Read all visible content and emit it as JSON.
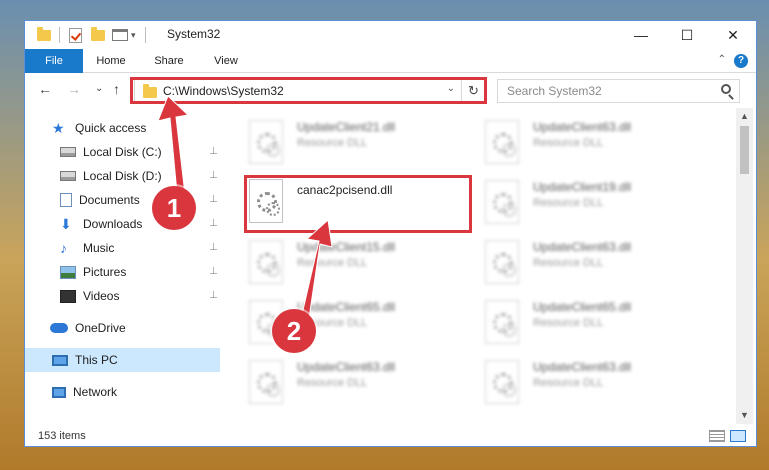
{
  "window": {
    "title": "System32",
    "controls": {
      "minimize": "—",
      "maximize": "☐",
      "close": "✕"
    }
  },
  "ribbon": {
    "tabs": [
      "File",
      "Home",
      "Share",
      "View"
    ],
    "help": "?",
    "collapse": "⌃"
  },
  "nav": {
    "back": "←",
    "forward": "→",
    "recent": "⌄",
    "up": "↑",
    "address": "C:\\Windows\\System32",
    "address_dropdown": "⌄",
    "refresh": "↻",
    "search_placeholder": "Search System32"
  },
  "sidebar": {
    "items": [
      {
        "label": "Quick access",
        "icon": "star-icon",
        "pinned": false
      },
      {
        "label": "Local Disk (C:)",
        "icon": "disk-icon",
        "pinned": true
      },
      {
        "label": "Local Disk (D:)",
        "icon": "disk-icon",
        "pinned": true
      },
      {
        "label": "Documents",
        "icon": "documents-icon",
        "pinned": true
      },
      {
        "label": "Downloads",
        "icon": "download-icon",
        "pinned": true
      },
      {
        "label": "Music",
        "icon": "music-icon",
        "pinned": true
      },
      {
        "label": "Pictures",
        "icon": "pictures-icon",
        "pinned": true
      },
      {
        "label": "Videos",
        "icon": "videos-icon",
        "pinned": true
      },
      {
        "label": "OneDrive",
        "icon": "cloud-icon",
        "pinned": false
      },
      {
        "label": "This PC",
        "icon": "computer-icon",
        "pinned": false,
        "selected": true
      },
      {
        "label": "Network",
        "icon": "network-icon",
        "pinned": false
      }
    ],
    "pin_glyph": "📌"
  },
  "files": {
    "left": [
      {
        "name": "UpdateClient21.dll",
        "type": "Resource DLL",
        "blurred": true
      },
      {
        "name": "canac2pcisend.dll",
        "type": "",
        "blurred": false
      },
      {
        "name": "UpdateClient15.dll",
        "type": "Resource DLL",
        "blurred": true
      },
      {
        "name": "UpdateClient65.dll",
        "type": "Resource DLL",
        "blurred": true
      },
      {
        "name": "UpdateClient63.dll",
        "type": "Resource DLL",
        "blurred": true
      }
    ],
    "right": [
      {
        "name": "UpdateClient63.dll",
        "type": "Resource DLL",
        "blurred": true
      },
      {
        "name": "UpdateClient19.dll",
        "type": "Resource DLL",
        "blurred": true
      },
      {
        "name": "UpdateClient63.dll",
        "type": "Resource DLL",
        "blurred": true
      },
      {
        "name": "UpdateClient65.dll",
        "type": "Resource DLL",
        "blurred": true
      },
      {
        "name": "UpdateClient63.dll",
        "type": "Resource DLL",
        "blurred": true
      }
    ]
  },
  "status": {
    "item_count": "153 items"
  },
  "annotations": {
    "step1": "1",
    "step2": "2",
    "color": "#d9363e"
  },
  "colors": {
    "accent": "#1979ca",
    "selected": "#cce8ff"
  }
}
